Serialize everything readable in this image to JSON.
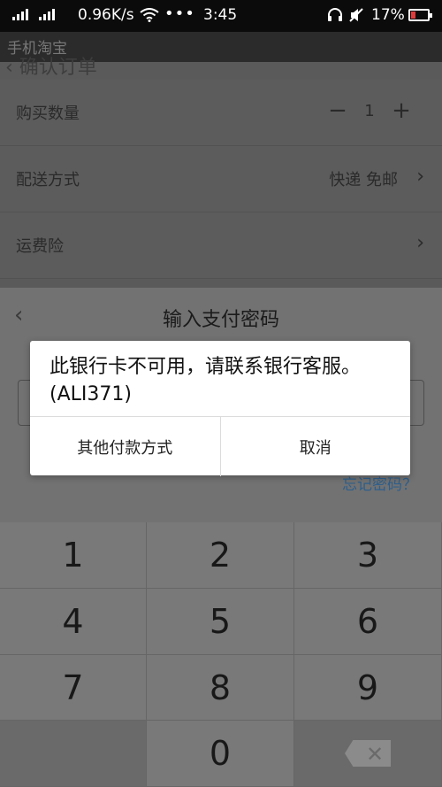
{
  "status_bar": {
    "net_speed": "0.96K/s",
    "dots": "•••",
    "time": "3:45",
    "battery": "17%"
  },
  "app_bar": {
    "title": "手机淘宝"
  },
  "page": {
    "partial_title": "确认订单"
  },
  "order": {
    "quantity_label": "购买数量",
    "minus": "−",
    "quantity": "1",
    "plus": "+",
    "delivery_label": "配送方式",
    "delivery_value": "快递 免邮",
    "insurance_label": "运费险",
    "chevron": "›"
  },
  "payment": {
    "back": "‹",
    "title": "输入支付密码",
    "forgot": "忘记密码？"
  },
  "keypad": {
    "keys": [
      "1",
      "2",
      "3",
      "4",
      "5",
      "6",
      "7",
      "8",
      "9",
      "0"
    ],
    "delete_glyph": "✕"
  },
  "dialog": {
    "message": "此银行卡不可用，请联系银行客服。(ALI371)",
    "other_method": "其他付款方式",
    "cancel": "取消"
  }
}
